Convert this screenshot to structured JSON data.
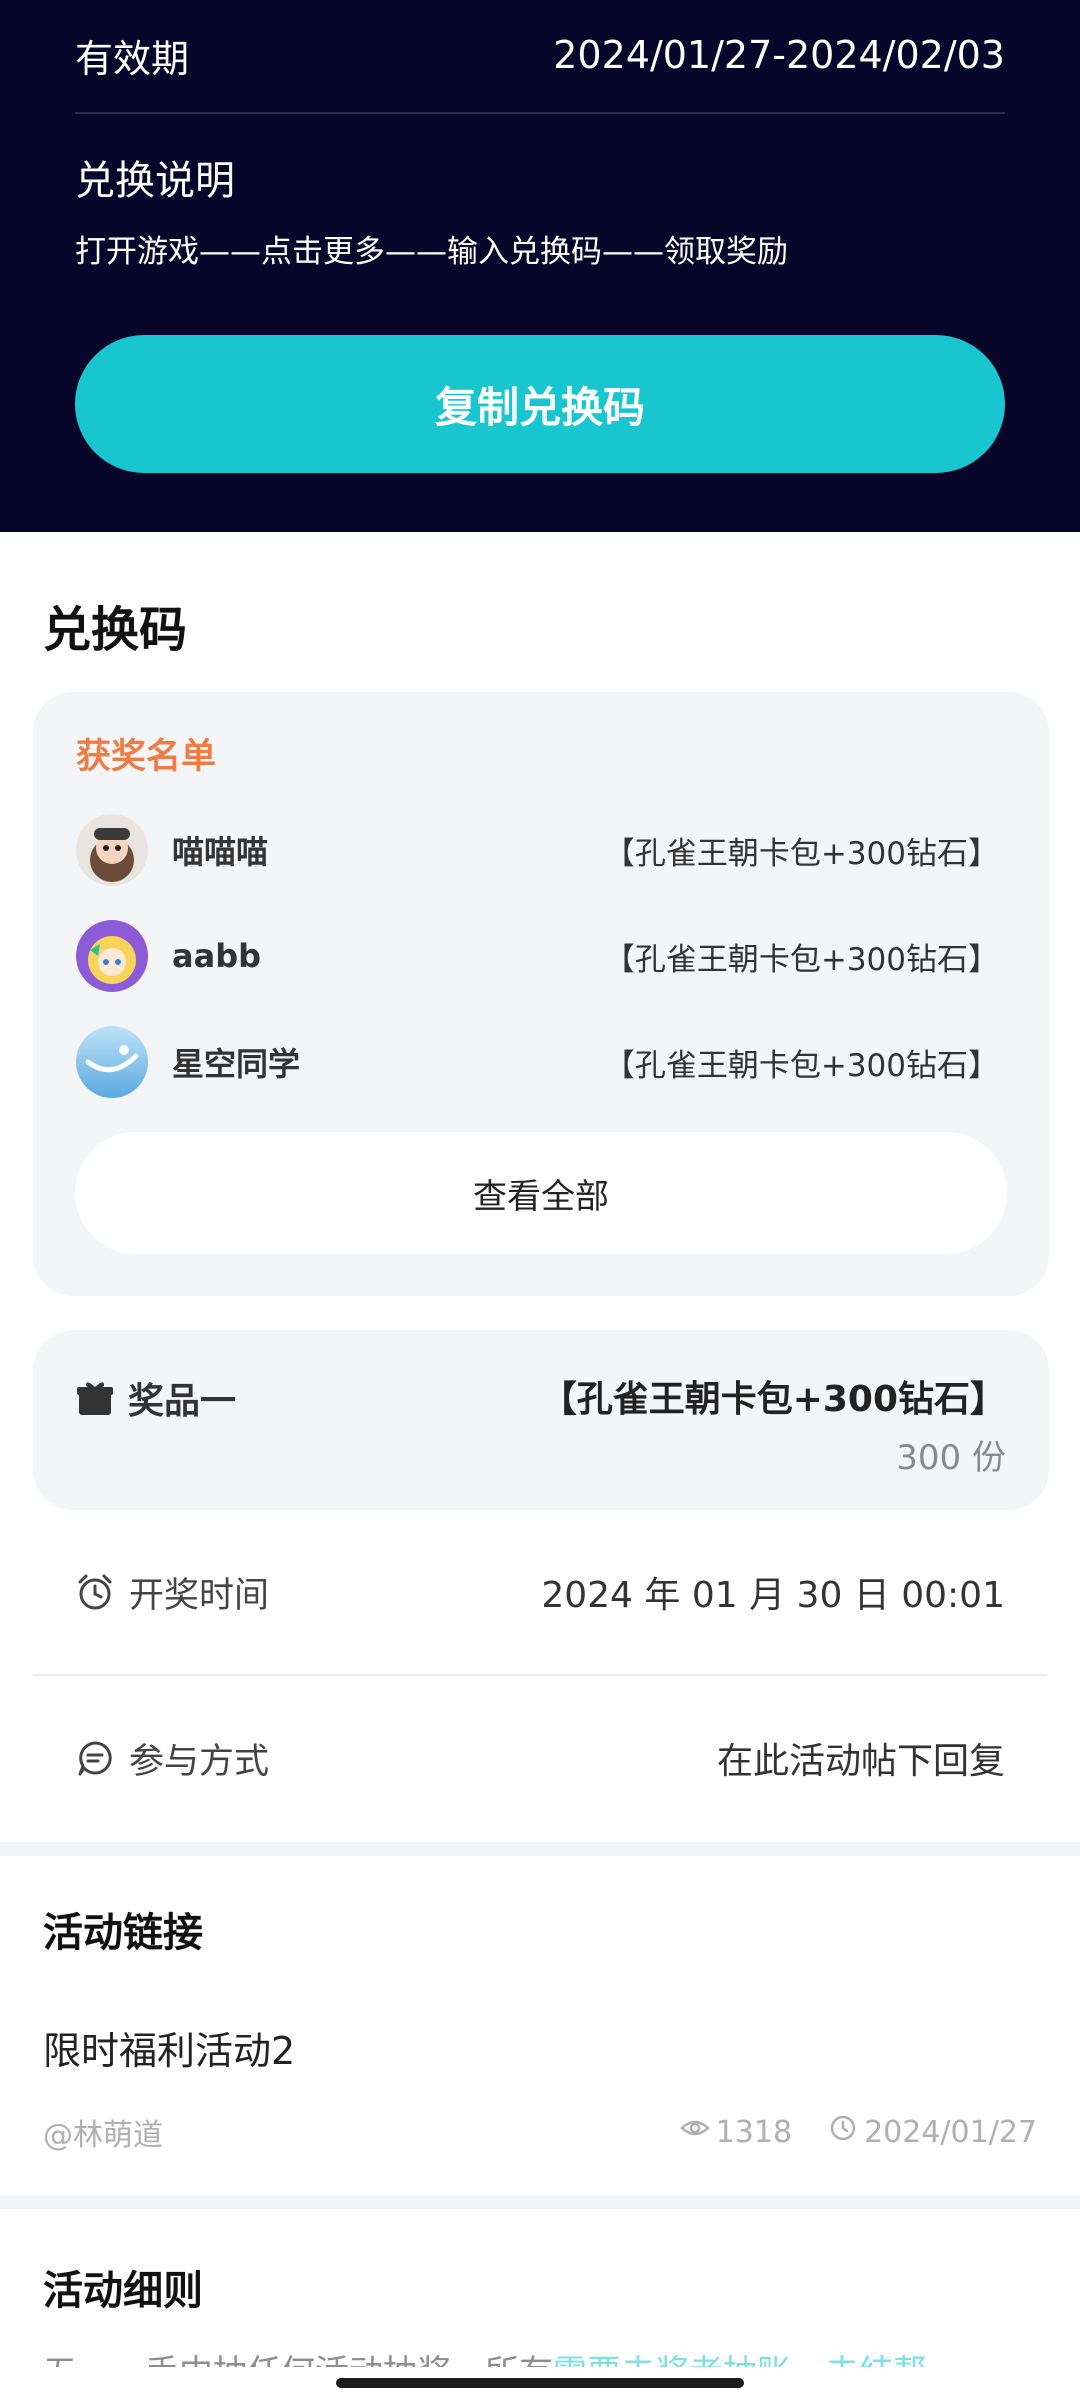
{
  "header": {
    "validity_label": "有效期",
    "validity_value": "2024/01/27-2024/02/03",
    "redeem_title": "兑换说明",
    "redeem_desc": "打开游戏——点击更多——输入兑换码——领取奖励",
    "copy_button": "复制兑换码"
  },
  "code_section": {
    "title": "兑换码",
    "winners_label": "获奖名单",
    "winners": [
      {
        "name": "喵喵喵",
        "prize": "【孔雀王朝卡包+300钻石】"
      },
      {
        "name": "aabb",
        "prize": "【孔雀王朝卡包+300钻石】"
      },
      {
        "name": "星空同学",
        "prize": "【孔雀王朝卡包+300钻石】"
      }
    ],
    "view_all": "查看全部"
  },
  "prize": {
    "label": "奖品一",
    "name": "【孔雀王朝卡包+300钻石】",
    "quantity": "300 份"
  },
  "draw_time": {
    "label": "开奖时间",
    "value": "2024 年 01 月 30 日 00:01"
  },
  "participation": {
    "label": "参与方式",
    "value": "在此活动帖下回复"
  },
  "activity_link": {
    "title": "活动链接",
    "post_title": "限时福利活动2",
    "author": "@林萌道",
    "views": "1318",
    "date": "2024/01/27"
  },
  "rules": {
    "title": "活动细则",
    "snippet_a": "五、一手中抽任何活动抽奖，所有",
    "snippet_b": "需要去奖者抽账，去结帮"
  },
  "colors": {
    "header_bg": "#07052a",
    "accent_teal": "#17c6cf",
    "winners_orange": "#f07c45",
    "card_bg": "#f4f5f7"
  },
  "icons": [
    "gift-icon",
    "alarm-clock-icon",
    "chat-bubble-icon",
    "eye-icon",
    "clock-icon"
  ]
}
